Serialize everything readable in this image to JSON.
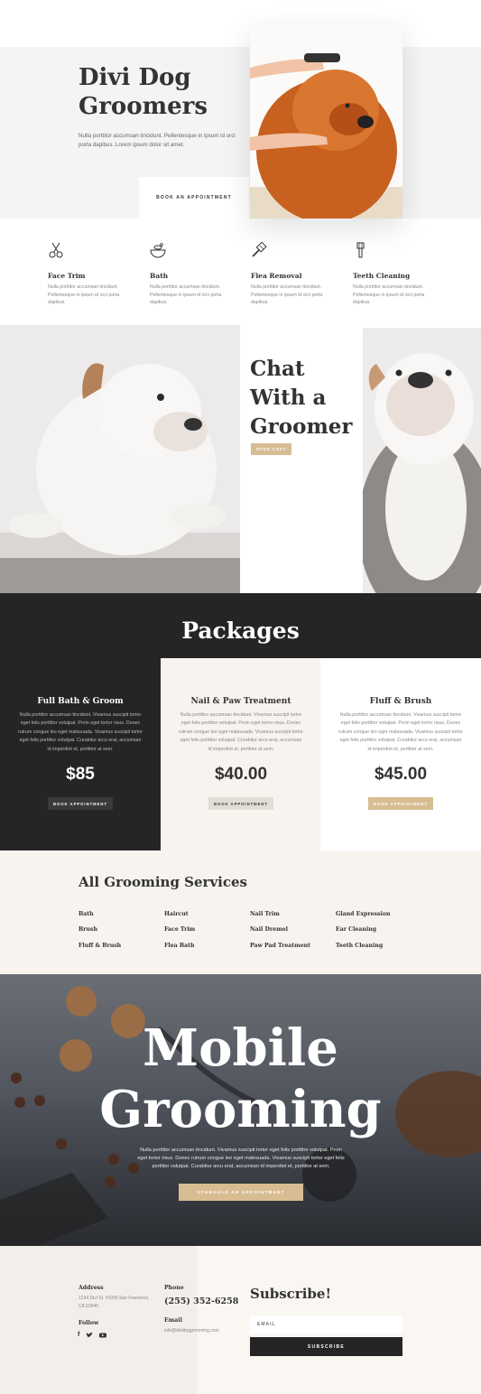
{
  "hero": {
    "title_line1": "Divi Dog",
    "title_line2": "Groomers",
    "text": "Nulla porttitor accumsan tincidunt. Pellentesque in ipsum id orci porta dapibus. Lorem ipsum dolor sit amet.",
    "button_label": "BOOK AN APPOINTMENT"
  },
  "services": [
    {
      "icon": "scissors-icon",
      "title": "Face Trim",
      "desc": "Nulla porttitor accumsan tincidunt. Pellentesque in ipsum id orci porta dapibus."
    },
    {
      "icon": "bowl-icon",
      "title": "Bath",
      "desc": "Nulla porttitor accumsan tincidunt. Pellentesque in ipsum id orci porta dapibus."
    },
    {
      "icon": "comb-icon",
      "title": "Flea Removal",
      "desc": "Nulla porttitor accumsan tincidunt. Pellentesque in ipsum id orci porta dapibus."
    },
    {
      "icon": "toothbrush-icon",
      "title": "Teeth Cleaning",
      "desc": "Nulla porttitor accumsan tincidunt. Pellentesque in ipsum id orci porta dapibus."
    }
  ],
  "chat": {
    "title_line1": "Chat",
    "title_line2": "With a",
    "title_line3": "Groomer",
    "button_label": "OPEN CHAT"
  },
  "packages": {
    "title": "Packages",
    "items": [
      {
        "name": "Full Bath & Groom",
        "desc": "Nulla porttitor accumsan tincidunt. Vivamus suscipit tortor eget felis porttitor volutpat. Proin eget tortor risus. Donec rutrum congue leo eget malesuada. Vivamus suscipit tortor eget felis porttitor volutpat. Curabitur arcu erat, accumsan id imperdiet et, porttitor at sem.",
        "price": "$85",
        "button_label": "BOOK APPOINTMENT"
      },
      {
        "name": "Nail & Paw Treatment",
        "desc": "Nulla porttitor accumsan tincidunt. Vivamus suscipit tortor eget felis porttitor volutpat. Proin eget tortor risus. Donec rutrum congue leo eget malesuada. Vivamus suscipit tortor eget felis porttitor volutpat. Curabitur arcu erat, accumsan id imperdiet et, porttitor at sem.",
        "price": "$40.00",
        "button_label": "BOOK APPOINTMENT"
      },
      {
        "name": "Fluff & Brush",
        "desc": "Nulla porttitor accumsan tincidunt. Vivamus suscipit tortor eget felis porttitor volutpat. Proin eget tortor risus. Donec rutrum congue leo eget malesuada. Vivamus suscipit tortor eget felis porttitor volutpat. Curabitur arcu erat, accumsan id imperdiet et, porttitor at sem.",
        "price": "$45.00",
        "button_label": "BOOK APPOINTMENT"
      }
    ]
  },
  "all_services": {
    "title": "All Grooming Services",
    "columns": [
      [
        "Bath",
        "Brush",
        "Fluff & Brush"
      ],
      [
        "Haircut",
        "Face Trim",
        "Flea Bath"
      ],
      [
        "Nail Trim",
        "Nail Dremel",
        "Paw Pad Treatment"
      ],
      [
        "Gland Expression",
        "Ear Cleaning",
        "Teeth Cleaning"
      ]
    ]
  },
  "mobile": {
    "title_line1": "Mobile",
    "title_line2": "Grooming",
    "text": "Nulla porttitor accumsan tincidunt. Vivamus suscipit tortor eget felis porttitor volutpat. Proin eget tortor risus. Donec rutrum congue leo eget malesuada. Vivamus suscipit tortor eget felis porttitor volutpat. Curabitur arcu erat, accumsan id imperdiet et, porttitor at sem.",
    "button_label": "SCHEDULE AN APPOINTMENT"
  },
  "footer": {
    "address_label": "Address",
    "address": "1234 Divi St. #1000 San Francisco, CA 93945",
    "follow_label": "Follow",
    "phone_label": "Phone",
    "phone": "(255) 352-6258",
    "email_label": "Email",
    "email": "info@dividoggrooming.com",
    "subscribe_title": "Subscribe!",
    "email_placeholder": "EMAIL",
    "subscribe_button": "SUBSCRIBE"
  },
  "colors": {
    "accent": "#d8bd93",
    "dark": "#252525",
    "light_bg": "#f4f4f4",
    "cream": "#f7f3ef"
  }
}
